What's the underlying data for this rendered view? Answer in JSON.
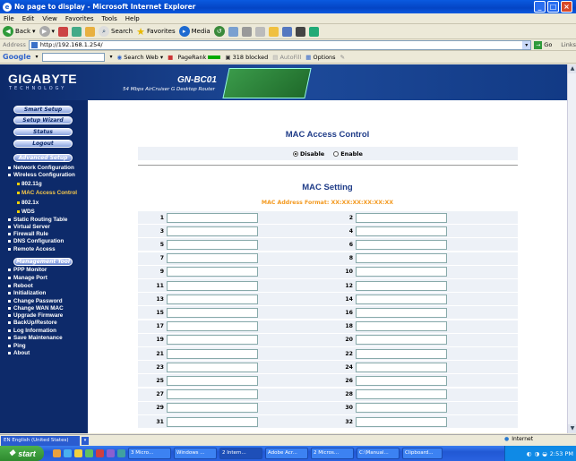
{
  "window": {
    "title": "No page to display - Microsoft Internet Explorer"
  },
  "menu": [
    "File",
    "Edit",
    "View",
    "Favorites",
    "Tools",
    "Help"
  ],
  "toolbar": {
    "back": "Back",
    "search": "Search",
    "favorites": "Favorites",
    "media": "Media"
  },
  "address": {
    "label": "Address",
    "url": "http://192.168.1.254/",
    "go": "Go",
    "links": "Links"
  },
  "googlebar": {
    "brand": "Google",
    "search_web": "Search Web",
    "pagerank": "PageRank",
    "blocked": "318 blocked",
    "autofill": "AutoFill",
    "options": "Options"
  },
  "header": {
    "brand": "GIGABYTE",
    "tagline": "TECHNOLOGY",
    "model": "GN-BC01",
    "subtitle": "54 Mbps AirCruiser G Desktop Router"
  },
  "sidebar": {
    "buttons": [
      "Smart Setup",
      "Setup Wizard",
      "Status",
      "Logout"
    ],
    "advanced_label": "Advanced Setup",
    "advanced": [
      "Network Configuration",
      "Wireless Configuration"
    ],
    "wireless_sub": [
      "802.11g",
      "MAC Access Control",
      "802.1x",
      "WDS"
    ],
    "advanced_more": [
      "Static Routing Table",
      "Virtual Server",
      "Firewall Rule",
      "DNS Configuration",
      "Remote Access"
    ],
    "management_label": "Management Tool",
    "management": [
      "PPP Monitor",
      "Manage Port",
      "Reboot",
      "Initialization",
      "Change Password",
      "Change WAN MAC",
      "Upgrade Firmware",
      "BackUp/Restore",
      "Log Information",
      "Save Maintenance",
      "Ping",
      "About"
    ]
  },
  "page": {
    "title": "MAC Access Control",
    "disable": "Disable",
    "enable": "Enable",
    "selected": "Disable",
    "setting_title": "MAC Setting",
    "format": "MAC Address Format: XX:XX:XX:XX:XX:XX",
    "rows": [
      [
        "1",
        "2"
      ],
      [
        "3",
        "4"
      ],
      [
        "5",
        "6"
      ],
      [
        "7",
        "8"
      ],
      [
        "9",
        "10"
      ],
      [
        "11",
        "12"
      ],
      [
        "13",
        "14"
      ],
      [
        "15",
        "16"
      ],
      [
        "17",
        "18"
      ],
      [
        "19",
        "20"
      ],
      [
        "21",
        "22"
      ],
      [
        "23",
        "24"
      ],
      [
        "25",
        "26"
      ],
      [
        "27",
        "28"
      ],
      [
        "29",
        "30"
      ],
      [
        "31",
        "32"
      ]
    ]
  },
  "status": {
    "language": "EN English (United States)",
    "zone": "Internet"
  },
  "taskbar": {
    "start": "start",
    "tasks": [
      "3 Micro...",
      "Windows ...",
      "2 Intern...",
      "Adobe Acr...",
      "2 Micros...",
      "C:\\Manual...",
      "Clipboard..."
    ],
    "time": "2:53 PM"
  }
}
